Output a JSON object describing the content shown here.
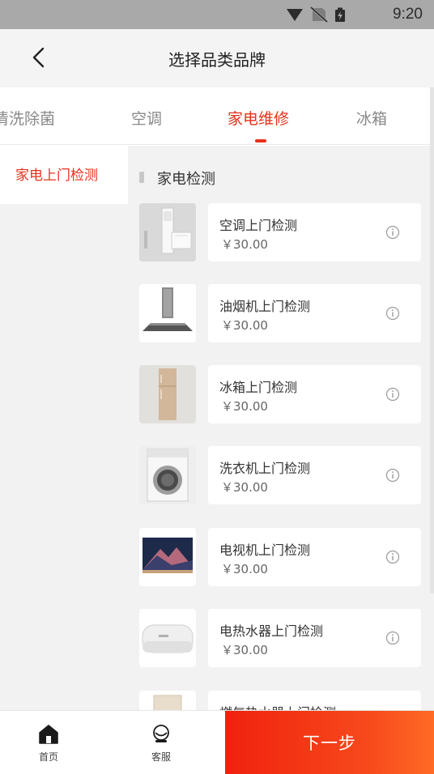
{
  "status_bar": {
    "time": "9:20",
    "icons": [
      "wifi-icon",
      "no-sim-icon",
      "battery-charging-icon"
    ]
  },
  "header": {
    "title": "选择品类品牌",
    "back_icon": "chevron-left-icon"
  },
  "tabs": [
    {
      "label": "清洗除菌",
      "active": false
    },
    {
      "label": "空调",
      "active": false
    },
    {
      "label": "家电维修",
      "active": true
    },
    {
      "label": "冰箱",
      "active": false
    }
  ],
  "sidebar": {
    "items": [
      {
        "label": "家电上门检测",
        "active": true
      }
    ]
  },
  "section": {
    "title": "家电检测",
    "items": [
      {
        "name": "空调上门检测",
        "price": "￥30.00",
        "image": "air-conditioner-image"
      },
      {
        "name": "油烟机上门检测",
        "price": "￥30.00",
        "image": "range-hood-image"
      },
      {
        "name": "冰箱上门检测",
        "price": "￥30.00",
        "image": "refrigerator-image"
      },
      {
        "name": "洗衣机上门检测",
        "price": "￥30.00",
        "image": "washing-machine-image"
      },
      {
        "name": "电视机上门检测",
        "price": "￥30.00",
        "image": "television-image"
      },
      {
        "name": "电热水器上门检测",
        "price": "￥30.00",
        "image": "water-heater-image"
      },
      {
        "name": "燃气热水器上门检测",
        "price": "",
        "image": "gas-water-heater-image"
      }
    ]
  },
  "bottom_nav": {
    "home_label": "首页",
    "service_label": "客服",
    "next_label": "下一步"
  },
  "colors": {
    "accent": "#e8311a",
    "button_gradient_start": "#f0210e",
    "button_gradient_end": "#ff6a25",
    "status_bar": "#a9a9a9",
    "panel_bg": "#f2f2f2"
  }
}
